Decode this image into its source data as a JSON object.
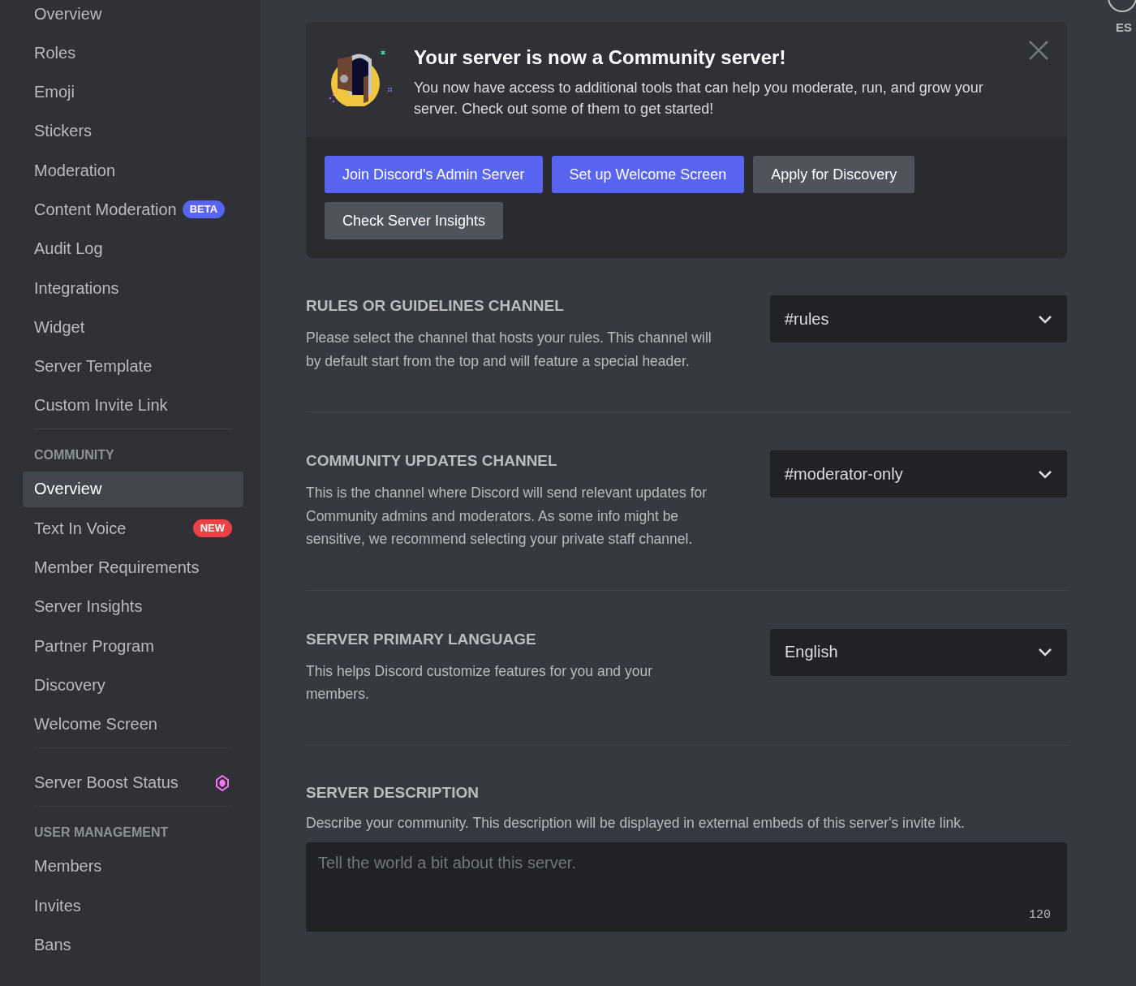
{
  "sidebar": {
    "sections": [
      {
        "items": [
          {
            "label": "Overview",
            "selected": false,
            "kind": "plain"
          },
          {
            "label": "Roles",
            "selected": false,
            "kind": "plain"
          },
          {
            "label": "Emoji",
            "selected": false,
            "kind": "plain"
          },
          {
            "label": "Stickers",
            "selected": false,
            "kind": "plain"
          },
          {
            "label": "Moderation",
            "selected": false,
            "kind": "plain"
          },
          {
            "label": "Content Moderation",
            "selected": false,
            "kind": "badged",
            "badge": {
              "text": "BETA",
              "kind": "beta"
            }
          },
          {
            "label": "Audit Log",
            "selected": false,
            "kind": "plain"
          },
          {
            "label": "Integrations",
            "selected": false,
            "kind": "plain"
          },
          {
            "label": "Widget",
            "selected": false,
            "kind": "plain"
          },
          {
            "label": "Server Template",
            "selected": false,
            "kind": "plain"
          },
          {
            "label": "Custom Invite Link",
            "selected": false,
            "kind": "plain"
          }
        ]
      },
      {
        "header": "COMMUNITY",
        "items": [
          {
            "label": "Overview",
            "selected": true,
            "kind": "plain"
          },
          {
            "label": "Text In Voice",
            "selected": false,
            "kind": "badged",
            "badge": {
              "text": "NEW",
              "kind": "new"
            }
          },
          {
            "label": "Member Requirements",
            "selected": false,
            "kind": "plain"
          },
          {
            "label": "Server Insights",
            "selected": false,
            "kind": "plain"
          },
          {
            "label": "Partner Program",
            "selected": false,
            "kind": "plain"
          },
          {
            "label": "Discovery",
            "selected": false,
            "kind": "plain"
          },
          {
            "label": "Welcome Screen",
            "selected": false,
            "kind": "plain"
          }
        ]
      },
      {
        "items": [
          {
            "label": "Server Boost Status",
            "selected": false,
            "kind": "boost"
          }
        ]
      },
      {
        "header": "USER MANAGEMENT",
        "items": [
          {
            "label": "Members",
            "selected": false,
            "kind": "plain"
          },
          {
            "label": "Invites",
            "selected": false,
            "kind": "plain"
          },
          {
            "label": "Bans",
            "selected": false,
            "kind": "plain"
          }
        ]
      }
    ]
  },
  "banner": {
    "title": "Your server is now a Community server!",
    "body": "You now have access to additional tools that can help you moderate, run, and grow your server. Check out some of them to get started!",
    "buttons": [
      {
        "label": "Join Discord's Admin Server",
        "kind": "primary"
      },
      {
        "label": "Set up Welcome Screen",
        "kind": "primary"
      },
      {
        "label": "Apply for Discovery",
        "kind": "secondary"
      },
      {
        "label": "Check Server Insights",
        "kind": "secondary"
      }
    ]
  },
  "settings": [
    {
      "title": "RULES OR GUIDELINES CHANNEL",
      "description": "Please select the channel that hosts your rules. This channel will by default start from the top and will feature a special header.",
      "value": "#rules"
    },
    {
      "title": "COMMUNITY UPDATES CHANNEL",
      "description": "This is the channel where Discord will send relevant updates for Community admins and moderators. As some info might be sensitive, we recommend selecting your private staff channel.",
      "value": "#moderator-only"
    },
    {
      "title": "SERVER PRIMARY LANGUAGE",
      "description": "This helps Discord customize features for you and your members.",
      "value": "English"
    }
  ],
  "server_description": {
    "title": "SERVER DESCRIPTION",
    "description": "Describe your community. This description will be displayed in external embeds of this server's invite link.",
    "placeholder": "Tell the world a bit about this server.",
    "counter": "120"
  },
  "esc": {
    "label": "ES"
  }
}
